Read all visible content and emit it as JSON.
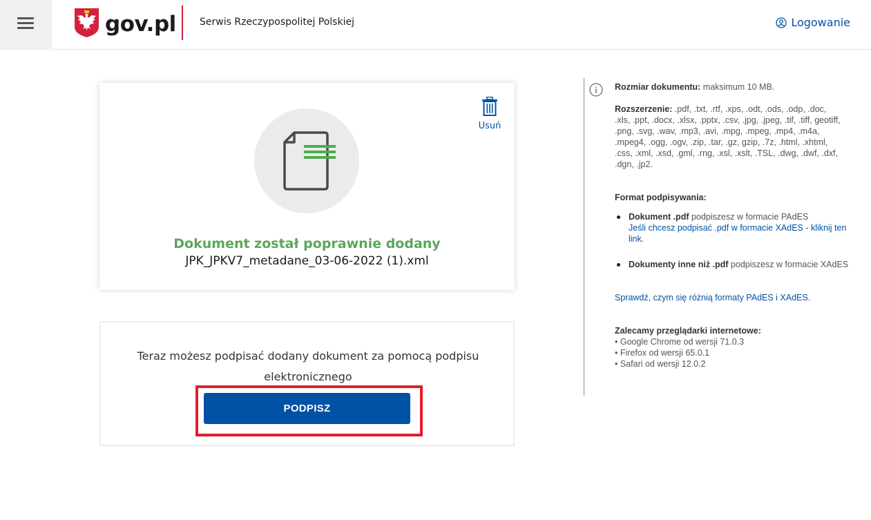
{
  "header": {
    "logo_text": "gov.pl",
    "service_name": "Serwis Rzeczypospolitej Polskiej",
    "login_label": "Logowanie"
  },
  "upload": {
    "delete_label": "Usuń",
    "success_message": "Dokument został poprawnie dodany",
    "filename": "JPK_JPKV7_metadane_03-06-2022 (1).xml"
  },
  "sign": {
    "prompt_line1": "Teraz możesz podpisać dodany dokument za pomocą podpisu",
    "prompt_line2": "elektronicznego",
    "button_label": "PODPISZ"
  },
  "info": {
    "size_label": "Rozmiar dokumentu:",
    "size_value": " maksimum 10 MB.",
    "ext_label": "Rozszerzenie:",
    "ext_value": " .pdf, .txt, .rtf, .xps, .odt, .ods, .odp, .doc, .xls, .ppt, .docx, .xlsx, .pptx, .csv, .jpg, .jpeg, .tif, .tiff, geotiff, .png, .svg, .wav, .mp3, .avi, .mpg, .mpeg, .mp4, .m4a, .mpeg4, .ogg, .ogv, .zip, .tar, .gz, gzip, .7z, .html, .xhtml, .css, .xml, .xsd, .gml, .rng, .xsl, .xslt, .TSL, .dwg, .dwf, .dxf, .dgn, .jp2.",
    "format_heading": "Format podpisywania:",
    "pdf_bold": "Dokument .pdf",
    "pdf_text": " podpiszesz w formacie PAdES",
    "pdf_link": "Jeśli chcesz podpisać .pdf w formacie XAdES - kliknij ten link.",
    "other_bold": "Dokumenty inne niż .pdf",
    "other_text": " podpiszesz w formacie XAdES",
    "compare_link": "Sprawdź, czym się różnią formaty PAdES i XAdES.",
    "browsers_heading": "Zalecamy przeglądarki internetowe:",
    "browsers": [
      "• Google Chrome od wersji 71.0.3",
      "• Firefox od wersji 65.0.1",
      "• Safari od wersji 12.0.2"
    ]
  },
  "colors": {
    "brand_blue": "#0052a5",
    "success_green": "#5ba65b",
    "highlight_red": "#e0202a",
    "flag_red": "#d4213d"
  }
}
